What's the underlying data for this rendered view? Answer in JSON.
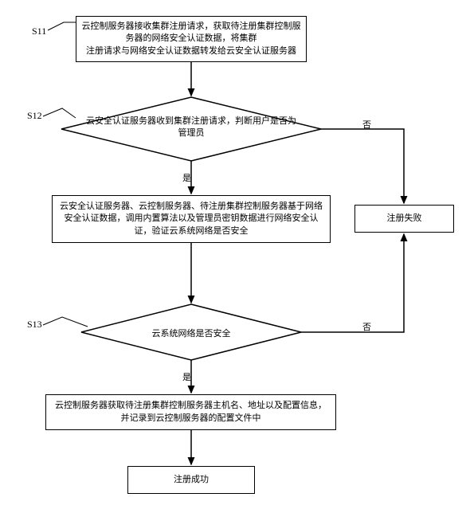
{
  "steps": {
    "s11_label": "S11",
    "s12_label": "S12",
    "s13_label": "S13"
  },
  "nodes": {
    "box1": "云控制服务器接收集群注册请求，获取待注册集群控制服务器的网络安全认证数据，将集群\n注册请求与网络安全认证数据转发给云安全认证服务器",
    "diamond1": "云安全认证服务器收到集群注册请求，判断用户是否为管理员",
    "box2": "云安全认证服务器、云控制服务器、待注册集群控制服务器基于网络安全认证数据，调用内置算法以及管理员密钥数据进行网络安全认证，验证云系统网络是否安全",
    "diamond2": "云系统网络是否安全",
    "box3": "云控制服务器获取待注册集群控制服务器主机名、地址以及配置信息，并记录到云控制服务器的配置文件中",
    "box_fail": "注册失败",
    "box_success": "注册成功"
  },
  "edges": {
    "yes": "是",
    "no": "否"
  },
  "chart_data": {
    "type": "flowchart",
    "nodes": [
      {
        "id": "S11",
        "type": "process",
        "label_ref": "box1"
      },
      {
        "id": "S12",
        "type": "decision",
        "label_ref": "diamond1"
      },
      {
        "id": "P2",
        "type": "process",
        "label_ref": "box2"
      },
      {
        "id": "S13",
        "type": "decision",
        "label_ref": "diamond2"
      },
      {
        "id": "P3",
        "type": "process",
        "label_ref": "box3"
      },
      {
        "id": "FAIL",
        "type": "process",
        "label_ref": "box_fail"
      },
      {
        "id": "OK",
        "type": "process",
        "label_ref": "box_success"
      }
    ],
    "edges": [
      {
        "from": "S11",
        "to": "S12"
      },
      {
        "from": "S12",
        "to": "P2",
        "label": "是"
      },
      {
        "from": "S12",
        "to": "FAIL",
        "label": "否"
      },
      {
        "from": "P2",
        "to": "S13"
      },
      {
        "from": "S13",
        "to": "P3",
        "label": "是"
      },
      {
        "from": "S13",
        "to": "FAIL",
        "label": "否"
      },
      {
        "from": "P3",
        "to": "OK"
      }
    ]
  }
}
